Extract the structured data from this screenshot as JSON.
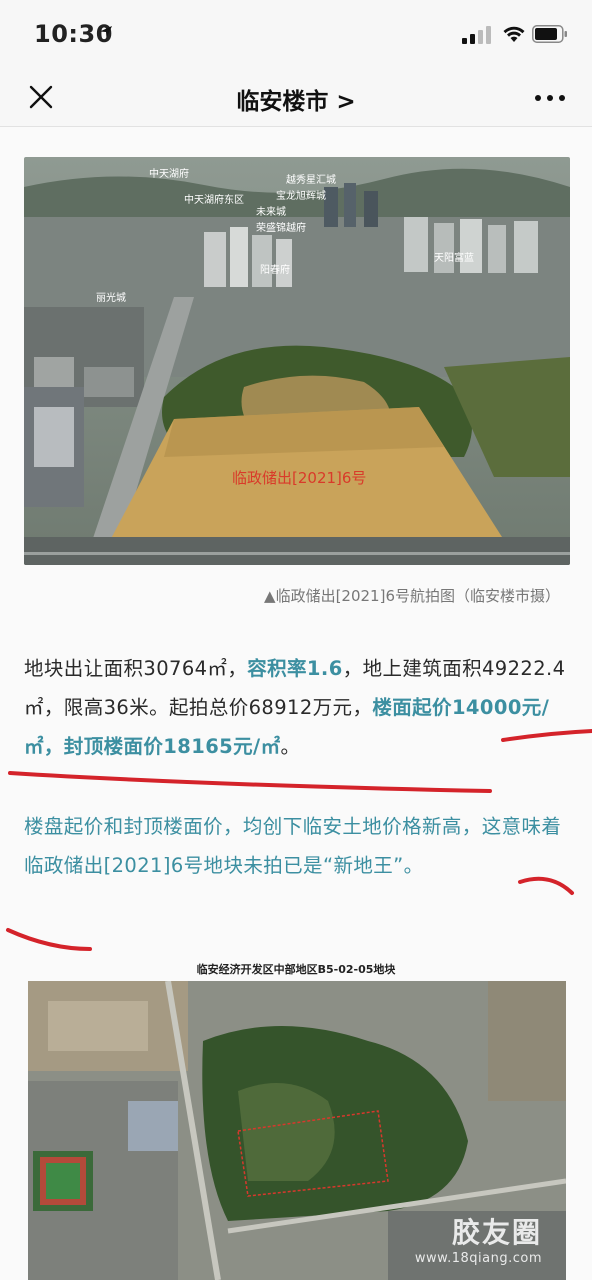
{
  "status": {
    "time": "10:30"
  },
  "nav": {
    "title": "临安楼市 >"
  },
  "article": {
    "photo1_labels": [
      "中天湖府",
      "中天湖府东区",
      "越秀星汇城",
      "宝龙旭辉城",
      "未来城",
      "荣盛锦越府",
      "阳春府",
      "天阳富蓝",
      "丽光城",
      "临政储出[2021]6号"
    ],
    "caption": "▲临政储出[2021]6号航拍图（临安楼市摄）",
    "p1": {
      "s1": "地块出让面积30764㎡，",
      "s2": "容积率1.6",
      "s3": "，地上建筑面积49222.4㎡，限高36米。起拍总价68912万元，",
      "s4": "楼面起价14000元/㎡，封顶楼面价18165元/㎡",
      "s5": "。"
    },
    "p2": "楼盘起价和封顶楼面价，均创下临安土地价格新高，这意味着临政储出[2021]6号地块未拍已是“新地王”。",
    "map_title": "临安经济开发区中部地区B5-02-05地块",
    "watermark": {
      "main": "胶友圈",
      "sub": "www.18qiang.com"
    }
  },
  "colors": {
    "accent_text": "#3c8fa1",
    "marker_red": "#d4232a",
    "background": "#f7f7f7"
  }
}
